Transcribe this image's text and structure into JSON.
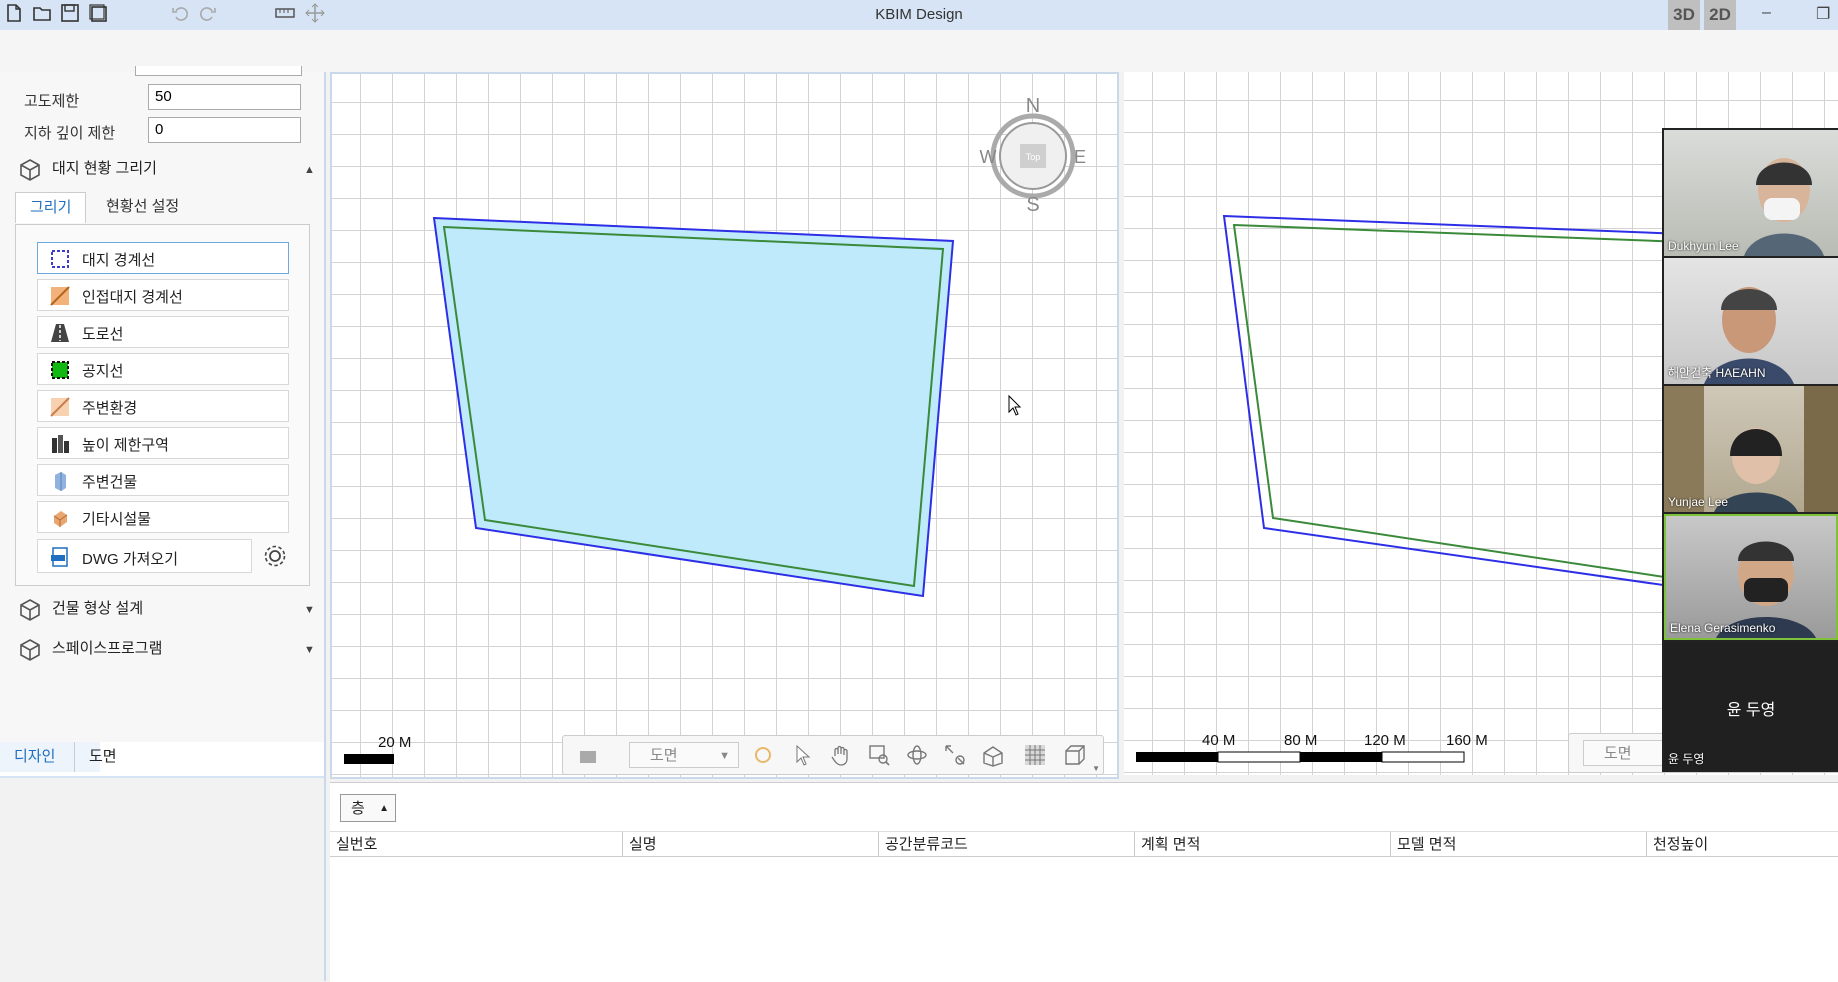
{
  "app": {
    "title": "KBIM Design",
    "mode_3d": "3D",
    "mode_2d": "2D",
    "minimize": "–",
    "restore": "❐"
  },
  "toolbar": {
    "icons": [
      "new-file-icon",
      "open-folder-icon",
      "save-icon",
      "save-all-icon",
      "undo-icon",
      "redo-icon",
      "ruler-icon",
      "move-icon"
    ]
  },
  "left_panel": {
    "height_limit_label": "고도제한",
    "height_limit_value": "50",
    "depth_limit_label": "지하 깊이 제한",
    "depth_limit_value": "0",
    "site_section": "대지 현황 그리기",
    "tabs": [
      "그리기",
      "현황선 설정"
    ],
    "tools": [
      {
        "label": "대지 경계선",
        "icon": "site-boundary-icon"
      },
      {
        "label": "인접대지 경계선",
        "icon": "adjacent-boundary-icon"
      },
      {
        "label": "도로선",
        "icon": "road-icon"
      },
      {
        "label": "공지선",
        "icon": "open-space-icon"
      },
      {
        "label": "주변환경",
        "icon": "environment-icon"
      },
      {
        "label": "높이 제한구역",
        "icon": "height-zone-icon"
      },
      {
        "label": "주변건물",
        "icon": "building-icon"
      },
      {
        "label": "기타시설물",
        "icon": "facility-icon"
      }
    ],
    "dwg_import": "DWG 가져오기",
    "building_section": "건물 형상 설계",
    "space_section": "스페이스프로그램",
    "bottom_tabs": [
      "디자인",
      "도면"
    ]
  },
  "viewport": {
    "compass": {
      "n": "N",
      "s": "S",
      "e": "E",
      "w": "W",
      "center": "Top"
    },
    "scale1": "20 M",
    "scale2": [
      "40 M",
      "80 M",
      "120 M",
      "160 M"
    ],
    "nav_dropdown": "도면"
  },
  "bottom_panel": {
    "floor_label": "층",
    "columns": [
      "실번호",
      "실명",
      "공간분류코드",
      "계획 면적",
      "모델 면적",
      "천정높이"
    ]
  },
  "video": {
    "participants": [
      "Dukhyun Lee",
      "해안건축 HAEAHN",
      "Yunjae Lee",
      "Elena Gerasimenko"
    ],
    "self_name": "윤 두영",
    "self_label": "윤 두영"
  },
  "colors": {
    "site_fill": "#bfeafb",
    "boundary": "#2d2ee6",
    "setback": "#3a8a3a",
    "titlebar": "#d6e4f5"
  }
}
